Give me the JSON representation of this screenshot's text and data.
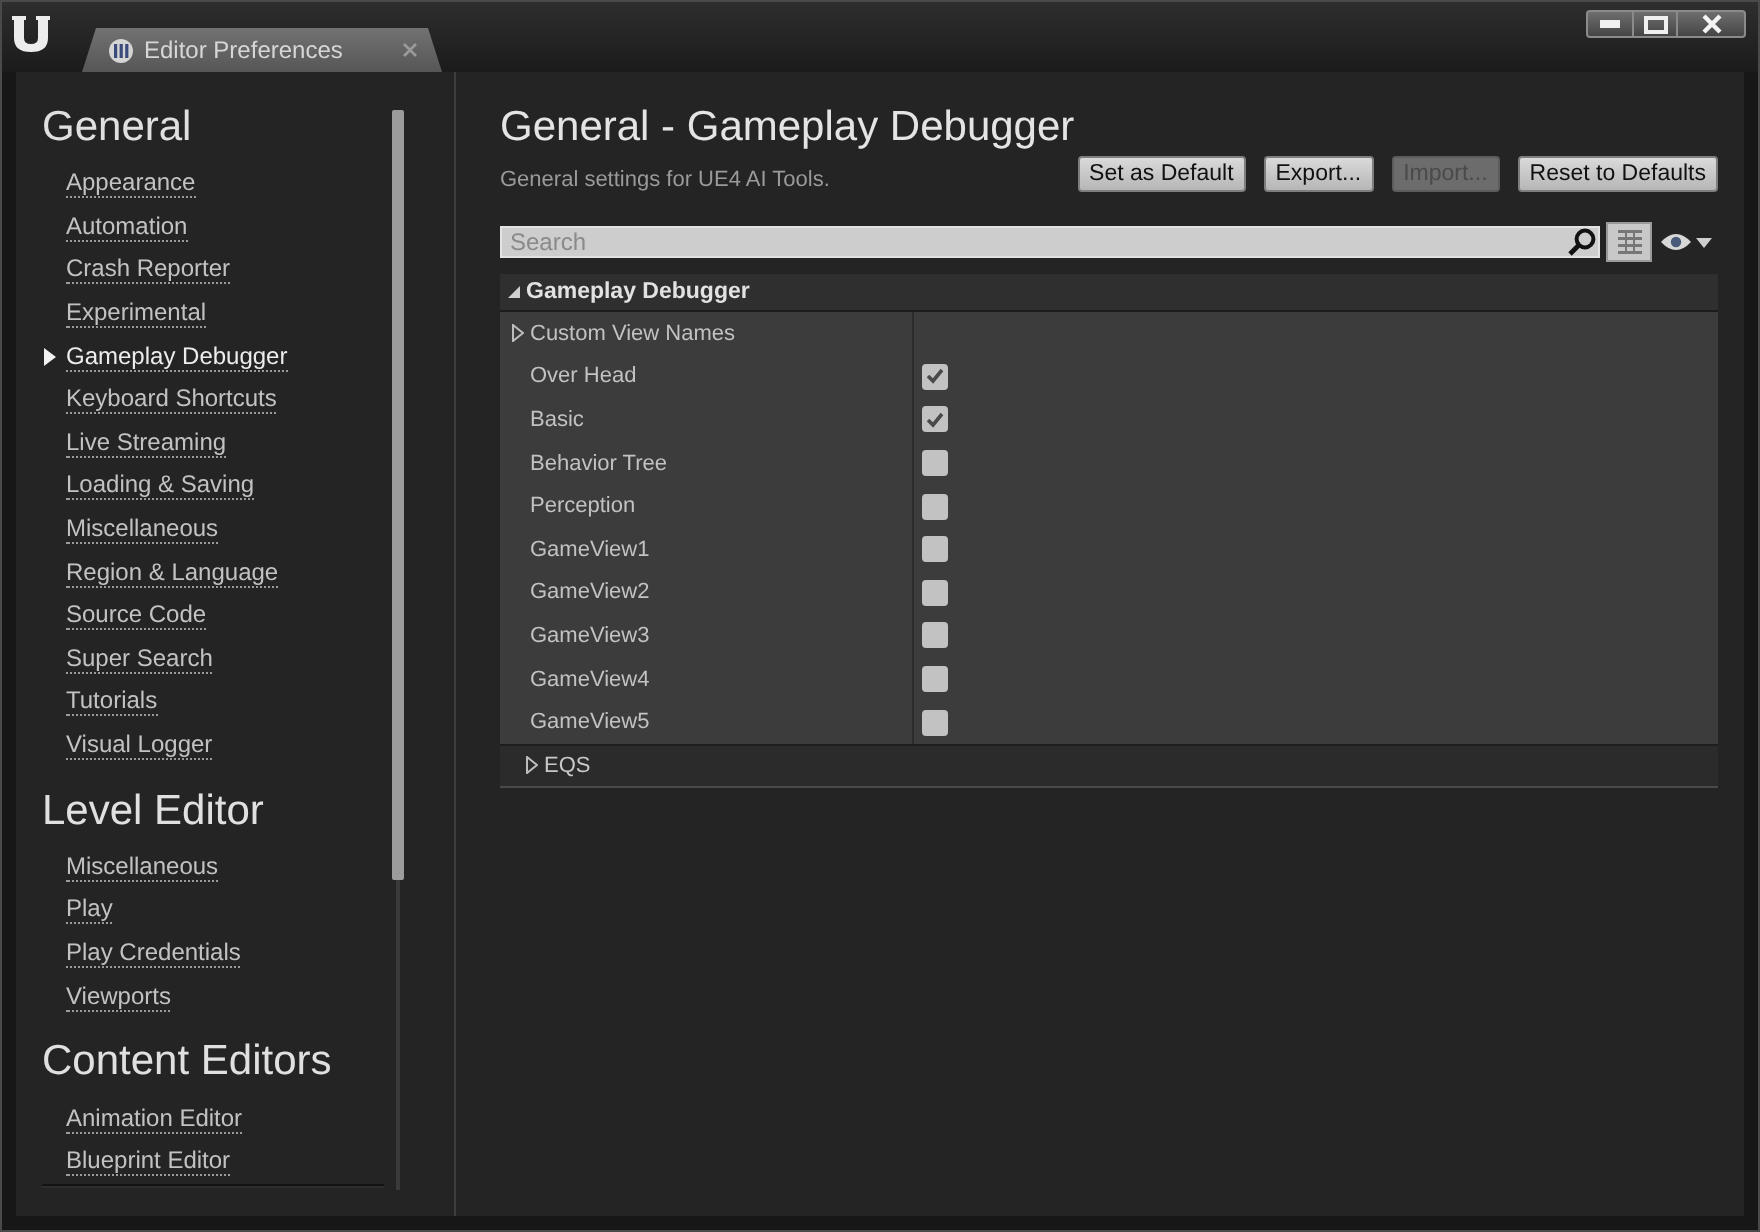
{
  "window": {
    "tab_title": "Editor Preferences"
  },
  "sidebar": {
    "sections": [
      {
        "heading": "General",
        "items": [
          {
            "label": "Appearance",
            "selected": false
          },
          {
            "label": "Automation",
            "selected": false
          },
          {
            "label": "Crash Reporter",
            "selected": false
          },
          {
            "label": "Experimental",
            "selected": false
          },
          {
            "label": "Gameplay Debugger",
            "selected": true
          },
          {
            "label": "Keyboard Shortcuts",
            "selected": false
          },
          {
            "label": "Live Streaming",
            "selected": false
          },
          {
            "label": "Loading & Saving",
            "selected": false
          },
          {
            "label": "Miscellaneous",
            "selected": false
          },
          {
            "label": "Region & Language",
            "selected": false
          },
          {
            "label": "Source Code",
            "selected": false
          },
          {
            "label": "Super Search",
            "selected": false
          },
          {
            "label": "Tutorials",
            "selected": false
          },
          {
            "label": "Visual Logger",
            "selected": false
          }
        ]
      },
      {
        "heading": "Level Editor",
        "items": [
          {
            "label": "Miscellaneous",
            "selected": false
          },
          {
            "label": "Play",
            "selected": false
          },
          {
            "label": "Play Credentials",
            "selected": false
          },
          {
            "label": "Viewports",
            "selected": false
          }
        ]
      },
      {
        "heading": "Content Editors",
        "items": [
          {
            "label": "Animation Editor",
            "selected": false
          },
          {
            "label": "Blueprint Editor",
            "selected": false
          }
        ]
      }
    ]
  },
  "page": {
    "title": "General - Gameplay Debugger",
    "description": "General settings for UE4 AI Tools.",
    "buttons": [
      {
        "label": "Set as Default",
        "disabled": false
      },
      {
        "label": "Export...",
        "disabled": false
      },
      {
        "label": "Import...",
        "disabled": true
      },
      {
        "label": "Reset to Defaults",
        "disabled": false
      }
    ]
  },
  "search": {
    "placeholder": "Search"
  },
  "details": {
    "category": {
      "title": "Gameplay Debugger",
      "expanded": true
    },
    "rows": [
      {
        "kind": "group",
        "label": "Custom View Names",
        "expanded": false
      },
      {
        "kind": "checkbox",
        "label": "Over Head",
        "checked": true
      },
      {
        "kind": "checkbox",
        "label": "Basic",
        "checked": true
      },
      {
        "kind": "checkbox",
        "label": "Behavior Tree",
        "checked": false
      },
      {
        "kind": "checkbox",
        "label": "Perception",
        "checked": false
      },
      {
        "kind": "checkbox",
        "label": "GameView1",
        "checked": false
      },
      {
        "kind": "checkbox",
        "label": "GameView2",
        "checked": false
      },
      {
        "kind": "checkbox",
        "label": "GameView3",
        "checked": false
      },
      {
        "kind": "checkbox",
        "label": "GameView4",
        "checked": false
      },
      {
        "kind": "checkbox",
        "label": "GameView5",
        "checked": false
      },
      {
        "kind": "subcategory",
        "label": "EQS",
        "expanded": false
      }
    ]
  }
}
